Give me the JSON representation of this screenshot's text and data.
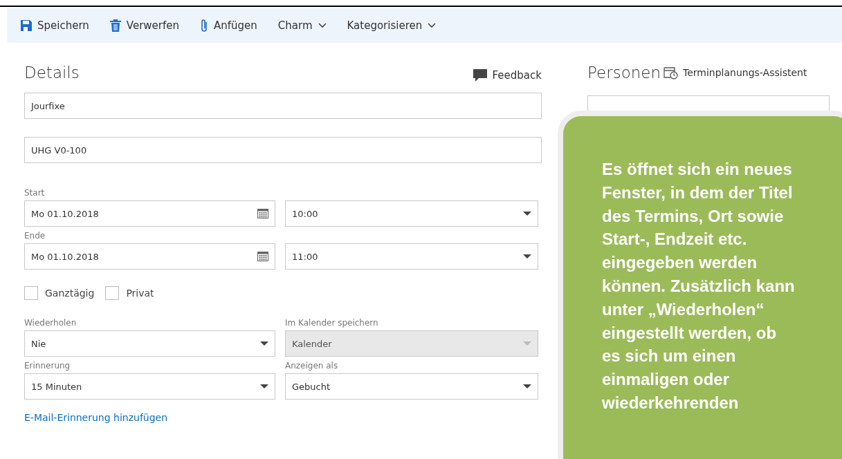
{
  "toolbar": [
    {
      "kind": "save",
      "label": "Speichern"
    },
    {
      "kind": "discard",
      "label": "Verwerfen"
    },
    {
      "kind": "attach",
      "label": "Anfügen"
    },
    {
      "kind": "menu",
      "label": "Charm"
    },
    {
      "kind": "menu",
      "label": "Kategorisieren"
    }
  ],
  "details": {
    "title": "Details",
    "feedback": "Feedback",
    "subject": {
      "value": "Jourfixe"
    },
    "location": {
      "value": "UHG V0-100"
    },
    "start": {
      "label": "Start",
      "date": "Mo 01.10.2018",
      "time": "10:00"
    },
    "end": {
      "label": "Ende",
      "date": "Mo 01.10.2018",
      "time": "11:00"
    },
    "checkboxes": [
      {
        "label": "Ganztägig",
        "checked": false
      },
      {
        "label": "Privat",
        "checked": false
      }
    ],
    "selects": [
      {
        "label": "Wiederholen",
        "value": "Nie",
        "disabled": false
      },
      {
        "label": "Im Kalender speichern",
        "value": "Kalender",
        "disabled": true
      },
      {
        "label": "Erinnerung",
        "value": "15 Minuten",
        "disabled": false
      },
      {
        "label": "Anzeigen als",
        "value": "Gebucht",
        "disabled": false
      }
    ],
    "link": "E-Mail-Erinnerung hinzufügen"
  },
  "people": {
    "title": "Personen",
    "assistant": "Terminplanungs-Assistent"
  },
  "callout": {
    "text": "Es öffnet sich ein neues Fenster, in dem der Titel des Termins, Ort sowie Start-, Endzeit etc. eingegeben werden können. Zusätzlich kann unter „Wiederholen“ eingestellt werden, ob es sich um einen einmaligen oder wiederkehrenden"
  }
}
